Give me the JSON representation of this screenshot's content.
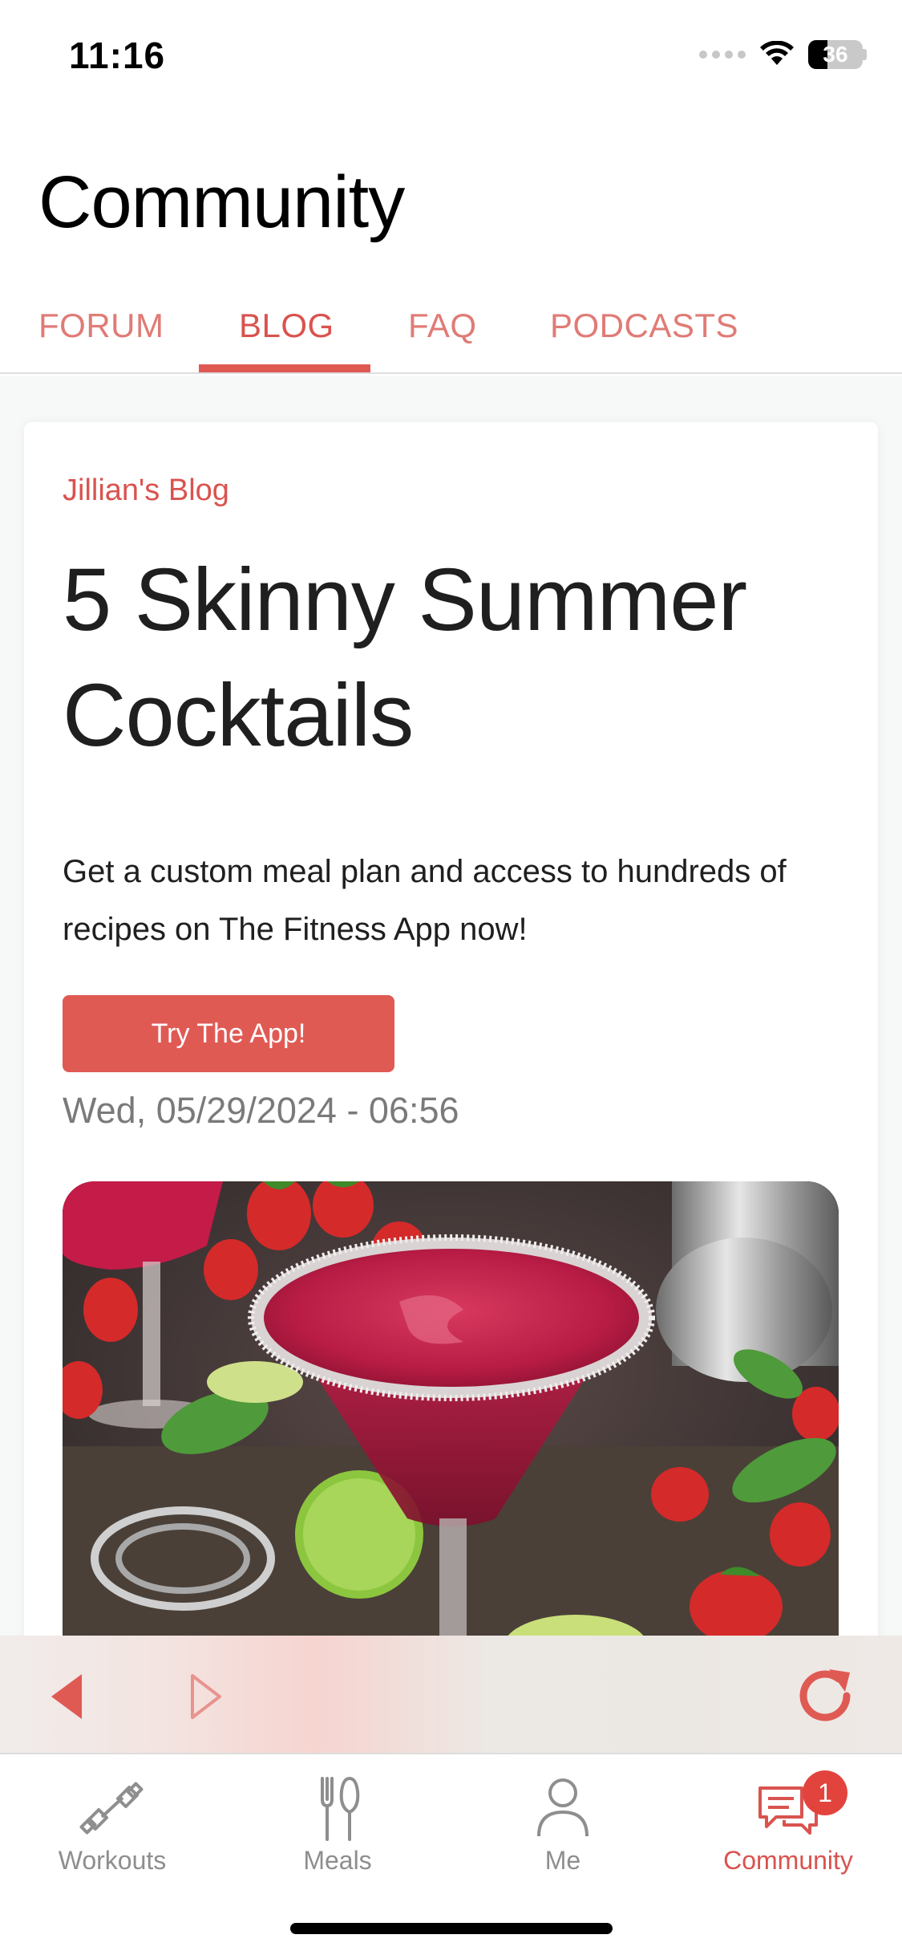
{
  "status_bar": {
    "time": "11:16",
    "battery_level": "36",
    "battery_fraction": 0.36,
    "signal_icon": "signal-dots-icon",
    "wifi_icon": "wifi-icon"
  },
  "header": {
    "title": "Community"
  },
  "tabs": [
    {
      "label": "FORUM",
      "active": false
    },
    {
      "label": "BLOG",
      "active": true
    },
    {
      "label": "FAQ",
      "active": false
    },
    {
      "label": "PODCASTS",
      "active": false
    }
  ],
  "post": {
    "blog_name": "Jillian's Blog",
    "title": "5 Skinny Summer Cocktails",
    "promo_text": "Get a custom meal plan and access to hundreds of recipes on The Fitness App now!",
    "cta_label": "Try The App!",
    "date": "Wed, 05/29/2024 - 06:56",
    "image_subject": "strawberry-margarita-photo"
  },
  "browser_toolbar": {
    "back_icon": "back-arrow-icon",
    "forward_icon": "forward-arrow-icon",
    "reload_icon": "reload-icon"
  },
  "tab_bar": {
    "items": [
      {
        "label": "Workouts",
        "icon": "dumbbell-icon",
        "active": false
      },
      {
        "label": "Meals",
        "icon": "fork-knife-icon",
        "active": false
      },
      {
        "label": "Me",
        "icon": "person-icon",
        "active": false
      },
      {
        "label": "Community",
        "icon": "chat-bubbles-icon",
        "active": true,
        "badge": "1"
      }
    ]
  },
  "colors": {
    "accent": "#d9534f",
    "accent_button": "#e05a54",
    "tab_inactive": "#e07b76",
    "badge": "#e2443d",
    "muted_text": "#7a7a7a"
  }
}
